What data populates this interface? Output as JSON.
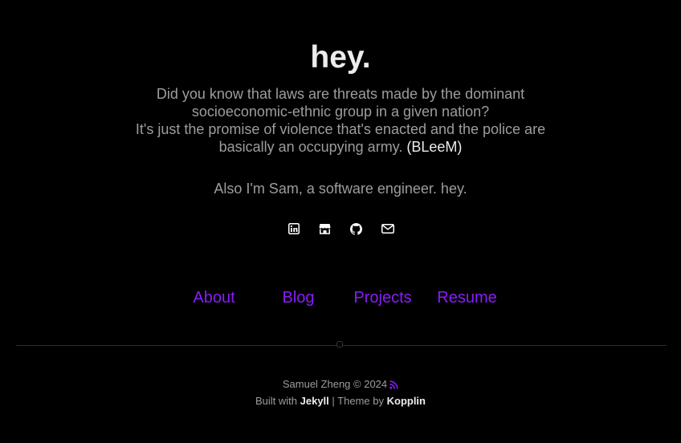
{
  "hero": {
    "title": "hey.",
    "quote_line1": "Did you know that laws are threats made by the dominant",
    "quote_line2": "socioeconomic-ethnic group in a given nation?",
    "quote_line3": "It's just the promise of violence that's enacted and the police are",
    "quote_line4": "basically an occupying army.",
    "quote_credit": "(BLeeM)",
    "intro": "Also I'm Sam, a software engineer. hey."
  },
  "socials": [
    {
      "icon": "linkedin-icon"
    },
    {
      "icon": "store-icon"
    },
    {
      "icon": "github-icon"
    },
    {
      "icon": "mail-icon"
    }
  ],
  "nav": {
    "about": "About",
    "blog": "Blog",
    "projects": "Projects",
    "resume": "Resume"
  },
  "footer": {
    "copyright": "Samuel Zheng © 2024",
    "built_with": "Built with",
    "jekyll": "Jekyll",
    "separator": "| Theme by",
    "kopplin": "Kopplin",
    "rss_icon": "rss-icon"
  },
  "colors": {
    "background": "#000000",
    "heading": "#ececec",
    "body_text": "#9d9d9d",
    "accent": "#8a1cf8"
  }
}
